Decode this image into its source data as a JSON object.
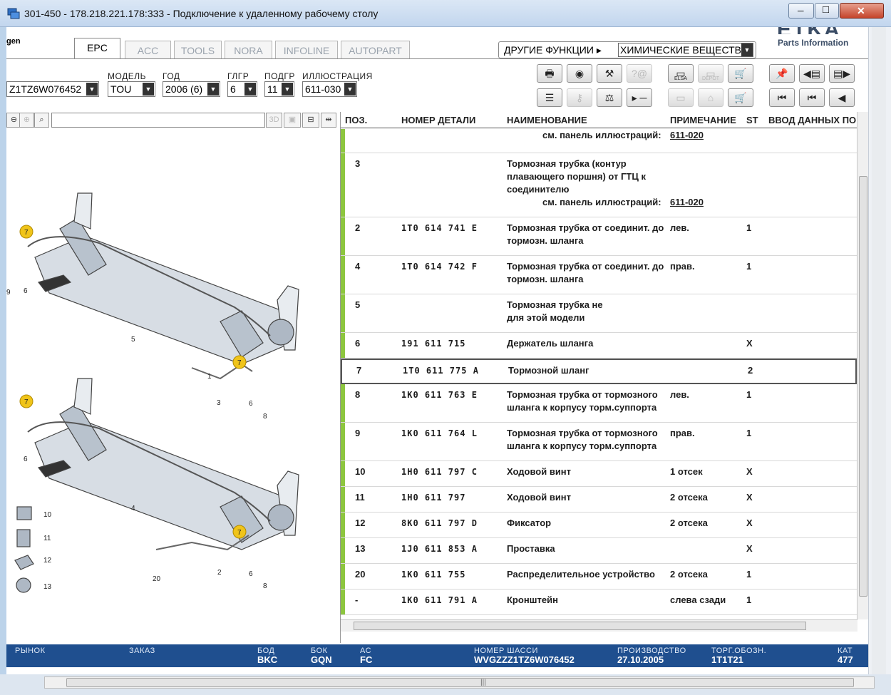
{
  "window": {
    "title": "301-450 - 178.218.221.178:333 - Подключение к удаленному рабочему столу",
    "minimize": "─",
    "maximize": "□",
    "close": "✕"
  },
  "app": {
    "brand_partial": "gen",
    "logo": "ETKA",
    "logo_sub": "Parts Information",
    "tabs": [
      {
        "label": "EPC",
        "active": true
      },
      {
        "label": "ACC",
        "active": false
      },
      {
        "label": "TOOLS",
        "active": false
      },
      {
        "label": "NORA",
        "active": false
      },
      {
        "label": "INFOLINE",
        "active": false
      },
      {
        "label": "AUTOPART",
        "active": false
      }
    ],
    "other_functions": {
      "label": "ДРУГИЕ ФУНКЦИИ ▸",
      "selected": "ХИМИЧЕСКИЕ ВЕЩЕСТВА"
    }
  },
  "selectors": {
    "vin": {
      "label": "",
      "value": "Z1TZ6W076452"
    },
    "model": {
      "label": "МОДЕЛЬ",
      "value": "TOU"
    },
    "year": {
      "label": "ГОД",
      "value": "2006 (6)"
    },
    "main_group": {
      "label": "ГЛГР",
      "value": "6"
    },
    "sub_group": {
      "label": "ПОДГР",
      "value": "11"
    },
    "illustration": {
      "label": "ИЛЛЮСТРАЦИЯ",
      "value": "611-030"
    }
  },
  "toolbar": {
    "elsa": "ELSA",
    "depot": "DEPOT",
    "minus": "▸ ─"
  },
  "illustration_toolbar": {
    "btn_3d": "3D"
  },
  "illustration": {
    "callouts": [
      "7",
      "7",
      "7",
      "7"
    ],
    "labels": [
      "9",
      "6",
      "5",
      "1",
      "3",
      "6",
      "8",
      "6",
      "4",
      "20",
      "2",
      "6",
      "8",
      "10",
      "11",
      "12",
      "13"
    ]
  },
  "table": {
    "headers": {
      "pos": "ПОЗ.",
      "part": "НОМЕР ДЕТАЛИ",
      "name": "НАИМЕНОВАНИЕ",
      "note": "ПРИМЕЧАНИЕ",
      "st": "ST",
      "input": "ВВОД ДАННЫХ ПО"
    },
    "ref_label": "см. панель иллюстраций:",
    "rows": [
      {
        "pos": "",
        "part": "",
        "name": "",
        "note": "",
        "st": "",
        "ref": "611-020"
      },
      {
        "pos": "3",
        "part": "",
        "name": "Тормозная трубка (контур плавающего поршня) от ГТЦ к соединителю",
        "note": "",
        "st": "",
        "ref": "611-020"
      },
      {
        "pos": "2",
        "part": "1T0 614 741 E",
        "name": "Тормозная трубка от соединит. до тормозн. шланга",
        "note": "лев.",
        "st": "1"
      },
      {
        "pos": "4",
        "part": "1T0 614 742 F",
        "name": "Тормозная трубка от соединит. до тормозн. шланга",
        "note": "прав.",
        "st": "1"
      },
      {
        "pos": "5",
        "part": "",
        "name": "Тормозная трубка не для этой модели",
        "note": "",
        "st": ""
      },
      {
        "pos": "6",
        "part": "191 611 715",
        "name": "Держатель шланга",
        "note": "",
        "st": "X"
      },
      {
        "pos": "7",
        "part": "1T0 611 775 A",
        "name": "Тормозной шланг",
        "note": "",
        "st": "2",
        "selected": true
      },
      {
        "pos": "8",
        "part": "1K0 611 763 E",
        "name": "Тормозная трубка от тормозного шланга к корпусу торм.суппорта",
        "note": "лев.",
        "st": "1"
      },
      {
        "pos": "9",
        "part": "1K0 611 764 L",
        "name": "Тормозная трубка от тормозного шланга к корпусу торм.суппорта",
        "note": "прав.",
        "st": "1"
      },
      {
        "pos": "10",
        "part": "1H0 611 797 C",
        "name": "Ходовой винт",
        "note": "1 отсек",
        "st": "X"
      },
      {
        "pos": "11",
        "part": "1H0 611 797",
        "name": "Ходовой винт",
        "note": "2 отсека",
        "st": "X"
      },
      {
        "pos": "12",
        "part": "8K0 611 797 D",
        "name": "Фиксатор",
        "note": "2 отсека",
        "st": "X"
      },
      {
        "pos": "13",
        "part": "1J0 611 853 A",
        "name": "Проставка",
        "note": "",
        "st": "X"
      },
      {
        "pos": "20",
        "part": "1K0 611 755",
        "name": "Распределительное устройство",
        "note": "2 отсека",
        "st": "1"
      },
      {
        "pos": "-",
        "part": "1K0 611 791 A",
        "name": "Кронштейн",
        "note": "слева сзади",
        "st": "1"
      }
    ]
  },
  "statusbar": {
    "market": {
      "label": "РЫНОК",
      "value": ""
    },
    "order": {
      "label": "ЗАКАЗ",
      "value": ""
    },
    "bod": {
      "label": "БОД",
      "value": "BKC"
    },
    "bok": {
      "label": "БОК",
      "value": "GQN"
    },
    "ac": {
      "label": "АС",
      "value": "FC"
    },
    "chassis": {
      "label": "НОМЕР ШАССИ",
      "value": "WVGZZZ1TZ6W076452"
    },
    "production": {
      "label": "ПРОИЗВОДСТВО",
      "value": "27.10.2005"
    },
    "trade": {
      "label": "ТОРГ.ОБОЗН.",
      "value": "1T1T21"
    },
    "cat": {
      "label": "КАТ",
      "value": "477"
    }
  },
  "colors": {
    "accent_bar": "#8dc63f",
    "status_bg": "#1f4f8f",
    "callout": "#f0c419"
  }
}
